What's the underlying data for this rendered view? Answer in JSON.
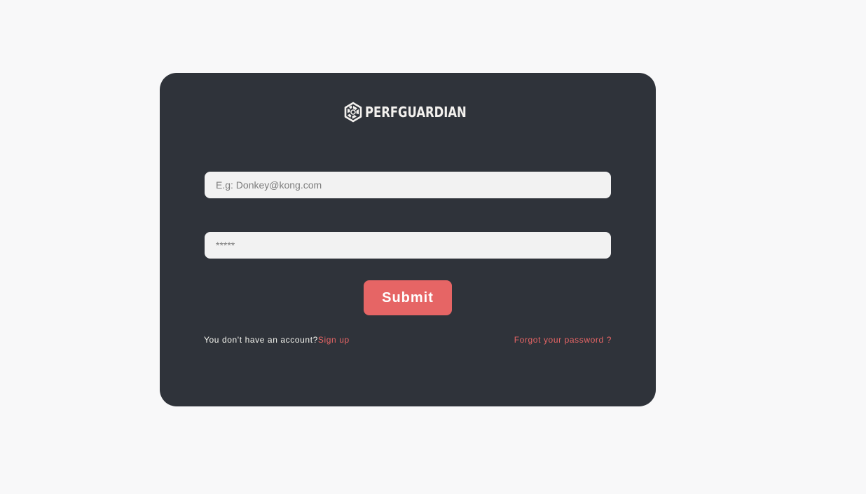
{
  "brand": {
    "name": "PERFGUARDIAN",
    "logo_icon": "perfguardian-logo-icon"
  },
  "login_form": {
    "email_placeholder": "E.g: Donkey@kong.com",
    "email_value": "",
    "password_placeholder": "*****",
    "password_value": "",
    "submit_label": "Submit",
    "signup_prompt": "You don't have an account?",
    "signup_link": "Sign up",
    "forgot_password_link": "Forgot your password ?"
  },
  "colors": {
    "page_background": "#f8f8f9",
    "card_background": "#2f333a",
    "accent": "#e66565",
    "input_background": "#f2f2f2",
    "text_light": "#f4f4ee"
  }
}
